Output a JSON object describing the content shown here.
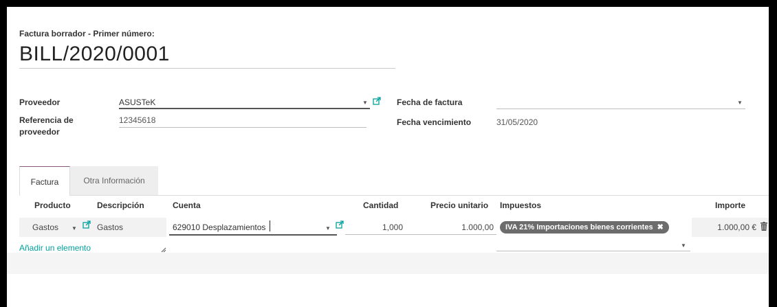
{
  "header": {
    "draft_label": "Factura borrador - Primer número:",
    "bill_number": "BILL/2020/0001"
  },
  "form": {
    "vendor_label": "Proveedor",
    "vendor_value": "ASUSTeK",
    "vendor_ref_label": "Referencia de proveedor",
    "vendor_ref_value": "12345618",
    "invoice_date_label": "Fecha de factura",
    "invoice_date_value": "",
    "due_date_label": "Fecha vencimiento",
    "due_date_value": "31/05/2020"
  },
  "tabs": [
    {
      "label": "Factura",
      "active": true
    },
    {
      "label": "Otra Información",
      "active": false
    }
  ],
  "table": {
    "headers": [
      "Producto",
      "Descripción",
      "Cuenta",
      "Cantidad",
      "Precio unitario",
      "Impuestos",
      "Importe"
    ],
    "row": {
      "product": "Gastos",
      "description": "Gastos",
      "account": "629010 Desplazamientos",
      "quantity": "1,000",
      "unit_price": "1.000,00",
      "tax": "IVA 21% Importaciones bienes corrientes",
      "amount": "1.000,00 €"
    },
    "add_line": "Añadir un elemento"
  },
  "colors": {
    "accent": "#00a09d",
    "tab_accent": "#875a7b",
    "badge": "#6c6c6c"
  },
  "icons": [
    "external-link-icon",
    "dropdown-caret-icon",
    "remove-tag-icon",
    "trash-icon",
    "resize-handle-icon"
  ]
}
